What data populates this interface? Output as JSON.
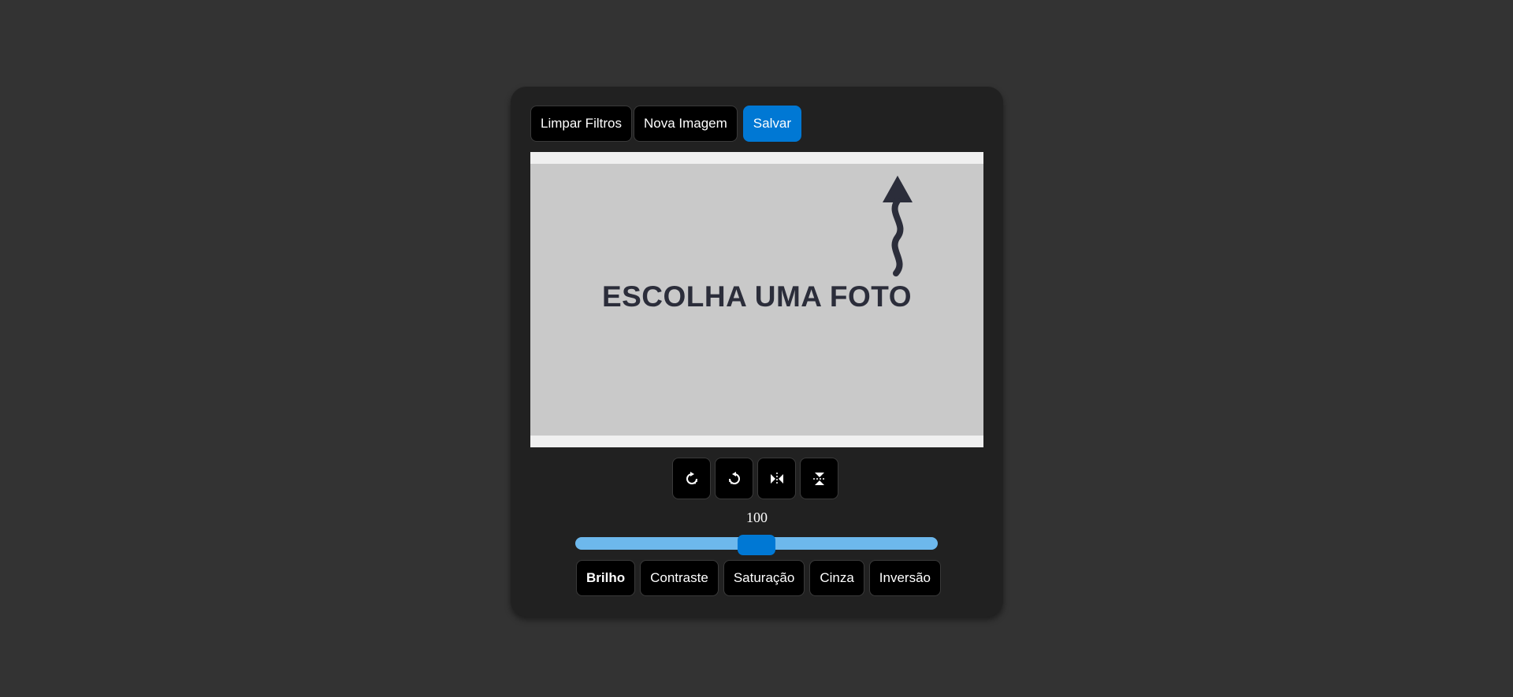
{
  "toolbar": {
    "clear_label": "Limpar Filtros",
    "new_image_label": "Nova Imagem",
    "save_label": "Salvar"
  },
  "preview": {
    "placeholder_text": "ESCOLHA UMA FOTO",
    "arrow_icon": "wavy-up-arrow-icon"
  },
  "tools": [
    {
      "icon": "rotate-right-icon"
    },
    {
      "icon": "rotate-left-icon"
    },
    {
      "icon": "flip-horizontal-icon"
    },
    {
      "icon": "flip-vertical-icon"
    }
  ],
  "slider": {
    "value": "100",
    "level": 0.5
  },
  "filters": [
    {
      "label": "Brilho",
      "active": true
    },
    {
      "label": "Contraste",
      "active": false
    },
    {
      "label": "Saturação",
      "active": false
    },
    {
      "label": "Cinza",
      "active": false
    },
    {
      "label": "Inversão",
      "active": false
    }
  ],
  "colors": {
    "background": "#333333",
    "panel": "#212121",
    "accent": "#0078d4",
    "slider_track": "#6db8ec",
    "preview_bg": "#c9c9c9",
    "placeholder_text": "#2b2d3a"
  }
}
